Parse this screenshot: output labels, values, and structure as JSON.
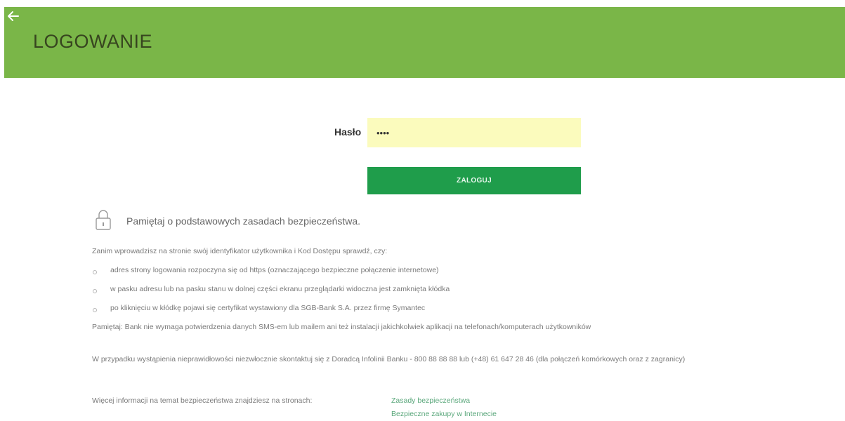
{
  "header": {
    "title": "LOGOWANIE"
  },
  "login": {
    "password_label": "Hasło",
    "password_value": "••••",
    "submit_label": "ZALOGUJ"
  },
  "security": {
    "heading": "Pamiętaj o podstawowych zasadach bezpieczeństwa.",
    "intro": "Zanim wprowadzisz na stronie swój identyfikator użytkownika i Kod Dostępu sprawdź, czy:",
    "checks": [
      "adres strony logowania rozpoczyna się od https (oznaczającego bezpieczne połączenie internetowe)",
      "w pasku adresu lub na pasku stanu w dolnej części ekranu przeglądarki widoczna jest zamknięta kłódka",
      "po kliknięciu w kłódkę pojawi się certyfikat wystawiony dla SGB-Bank S.A. przez firmę Symantec"
    ],
    "note": "Pamiętaj: Bank nie wymaga potwierdzenia danych SMS-em lub mailem ani też instalacji jakichkolwiek aplikacji na telefonach/komputerach użytkowników",
    "contact": "W przypadku wystąpienia nieprawidłowości niezwłocznie skontaktuj się z Doradcą Infolinii Banku - 800 88 88 88 lub (+48) 61 647 28 46 (dla połączeń komórkowych oraz z zagranicy)",
    "more_info": "Więcej informacji na temat bezpieczeństwa znajdziesz na stronach:",
    "links": [
      "Zasady bezpieczeństwa",
      "Bezpieczne zakupy w Internecie"
    ]
  },
  "colors": {
    "header_bg": "#7ab648",
    "button_bg": "#1f9d4b",
    "input_bg": "#fbfbbd",
    "link": "#5aa77b"
  },
  "icons": {
    "back": "arrow-left-icon",
    "lock": "padlock-icon"
  }
}
